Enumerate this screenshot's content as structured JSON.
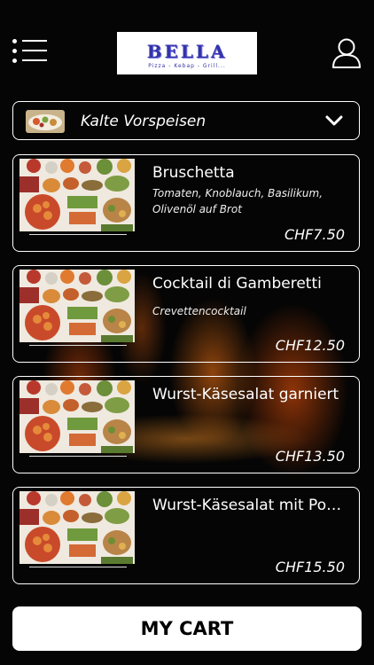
{
  "header": {
    "logo_name": "BELLA",
    "logo_tagline": "Pizza - Kebap - Grill..."
  },
  "category": {
    "label": "Kalte Vorspeisen"
  },
  "items": [
    {
      "title": "Bruschetta",
      "description": "Tomaten, Knoblauch, Basilikum, Olivenöl auf Brot",
      "price": "CHF7.50"
    },
    {
      "title": "Cocktail di Gamberetti",
      "description": "Crevettencocktail",
      "price": "CHF12.50"
    },
    {
      "title": "Wurst-Käsesalat garniert",
      "description": "",
      "price": "CHF13.50"
    },
    {
      "title": "Wurst-Käsesalat mit Pom...",
      "description": "",
      "price": "CHF15.50"
    }
  ],
  "cart": {
    "label": "MY CART"
  },
  "colors": {
    "background": "#050505",
    "logo_text": "#3333aa",
    "fire": "#ff7a14"
  },
  "icons": [
    "menu-icon",
    "user-icon",
    "chevron-down-icon"
  ]
}
